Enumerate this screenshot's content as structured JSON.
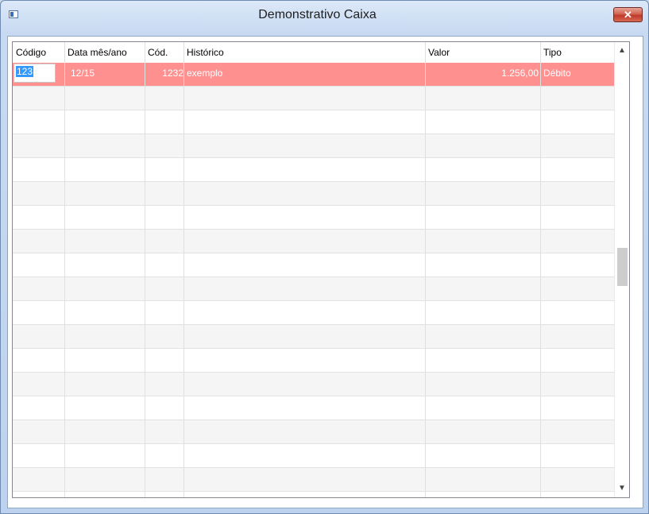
{
  "window": {
    "title": "Demonstrativo Caixa",
    "close_label": "✕"
  },
  "columns": [
    "Código",
    "Data mês/ano",
    "Cód.",
    "Histórico",
    "Valor",
    "Tipo"
  ],
  "rows": [
    {
      "codigo": "123",
      "data": "12/15",
      "cod": "1232",
      "historico": "exemplo",
      "valor": "1.256,00",
      "tipo": "Débito"
    }
  ],
  "scrollbar": {
    "up_icon": "▲",
    "down_icon": "▼"
  }
}
